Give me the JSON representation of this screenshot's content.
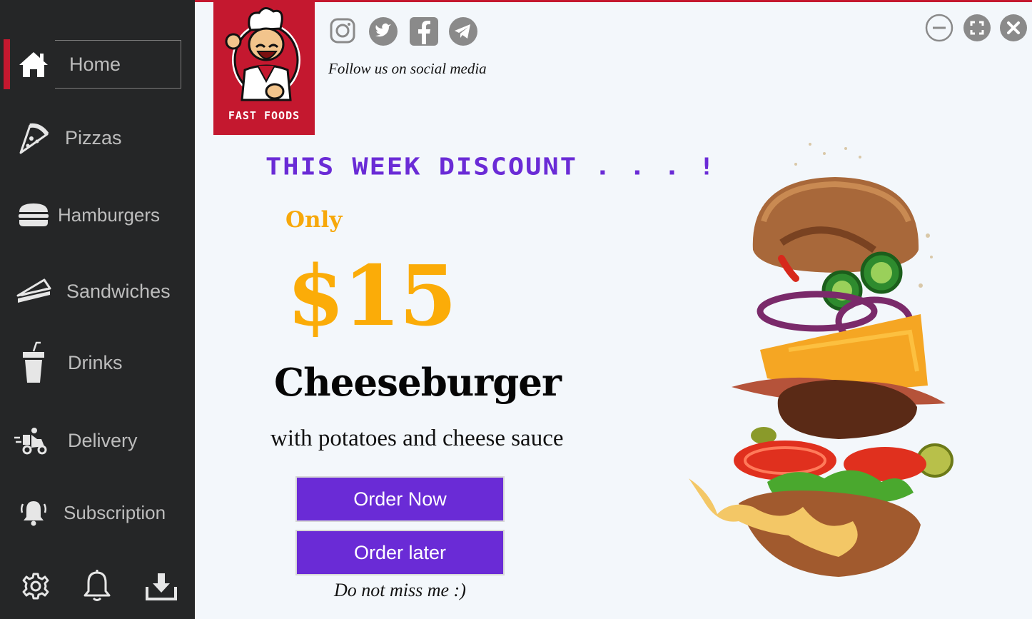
{
  "sidebar": {
    "items": [
      {
        "label": "Home",
        "icon": "home-icon",
        "active": true
      },
      {
        "label": "Pizzas",
        "icon": "pizza-icon"
      },
      {
        "label": "Hamburgers",
        "icon": "hamburger-icon"
      },
      {
        "label": "Sandwiches",
        "icon": "sandwich-icon"
      },
      {
        "label": "Drinks",
        "icon": "drink-icon"
      },
      {
        "label": "Delivery",
        "icon": "delivery-icon"
      },
      {
        "label": "Subscription",
        "icon": "subscription-bell-icon"
      }
    ],
    "bottom_icons": [
      "settings-gear-icon",
      "notification-bell-icon",
      "download-icon"
    ]
  },
  "logo": {
    "text": "FAST FOODS"
  },
  "social": {
    "icons": [
      "instagram-icon",
      "twitter-icon",
      "facebook-icon",
      "telegram-icon"
    ],
    "follow_text": "Follow us on social media"
  },
  "window_controls": [
    "minimize-icon",
    "maximize-icon",
    "close-icon"
  ],
  "promo": {
    "heading": "THIS WEEK DISCOUNT . . . !",
    "only": "Only",
    "price": "$15",
    "product": "Cheeseburger",
    "subtitle": "with potatoes and cheese sauce",
    "order_now": "Order Now",
    "order_later": "Order later",
    "tagline": "Do not miss me :)"
  },
  "colors": {
    "accent_red": "#c4182f",
    "purple": "#6a2bd6",
    "price_orange": "#fbac08",
    "sidebar_bg": "#252627"
  }
}
